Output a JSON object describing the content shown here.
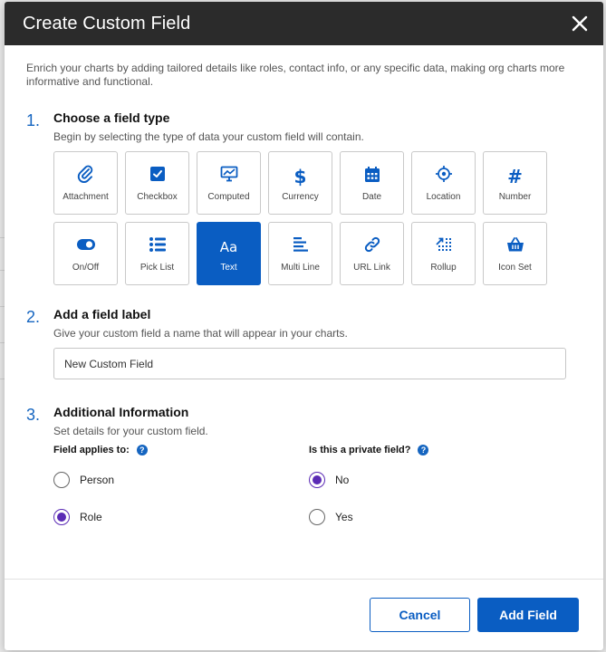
{
  "modal": {
    "title": "Create Custom Field",
    "intro": "Enrich your charts by adding tailored details like roles, contact info, or any specific data, making org charts more informative and functional."
  },
  "step1": {
    "number": "1.",
    "title": "Choose a field type",
    "description": "Begin by selecting the type of data your custom field will contain.",
    "field_types": [
      {
        "label": "Attachment",
        "icon": "paperclip-icon"
      },
      {
        "label": "Checkbox",
        "icon": "checkbox-icon"
      },
      {
        "label": "Computed",
        "icon": "chart-monitor-icon"
      },
      {
        "label": "Currency",
        "icon": "dollar-icon"
      },
      {
        "label": "Date",
        "icon": "calendar-icon"
      },
      {
        "label": "Location",
        "icon": "crosshair-icon"
      },
      {
        "label": "Number",
        "icon": "hash-icon"
      },
      {
        "label": "On/Off",
        "icon": "toggle-icon"
      },
      {
        "label": "Pick List",
        "icon": "list-icon"
      },
      {
        "label": "Text",
        "icon": "text-aa-icon",
        "selected": true
      },
      {
        "label": "Multi Line",
        "icon": "multiline-icon"
      },
      {
        "label": "URL Link",
        "icon": "link-icon"
      },
      {
        "label": "Rollup",
        "icon": "rollup-icon"
      },
      {
        "label": "Icon Set",
        "icon": "basket-icon"
      }
    ]
  },
  "step2": {
    "number": "2.",
    "title": "Add a field label",
    "description": "Give your custom field a name that will appear in your charts.",
    "input_value": "New Custom Field"
  },
  "step3": {
    "number": "3.",
    "title": "Additional Information",
    "description": "Set details for your custom field.",
    "applies_to": {
      "question": "Field applies to:",
      "options": [
        {
          "label": "Person",
          "checked": false
        },
        {
          "label": "Role",
          "checked": true
        }
      ]
    },
    "private": {
      "question": "Is this a private field?",
      "options": [
        {
          "label": "No",
          "checked": true
        },
        {
          "label": "Yes",
          "checked": false
        }
      ]
    }
  },
  "footer": {
    "cancel_label": "Cancel",
    "add_label": "Add Field"
  },
  "colors": {
    "accent": "#0a5dc2",
    "radio_checked": "#5b2bb5",
    "header_bg": "#2b2b2b"
  }
}
